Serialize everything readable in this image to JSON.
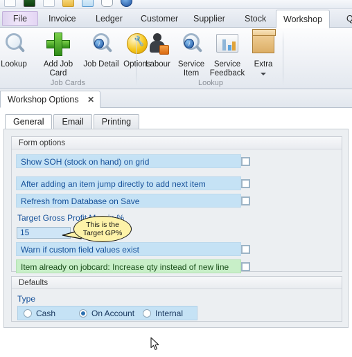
{
  "quick_access": {
    "icons": [
      "pencil-icon",
      "monitor-green-icon",
      "blank-page-icon",
      "folder-icon",
      "window-blue-icon",
      "comment-icon",
      "info-icon"
    ]
  },
  "ribbon": {
    "tabs": [
      {
        "label": "File",
        "active": false
      },
      {
        "label": "Invoice",
        "active": false
      },
      {
        "label": "Ledger",
        "active": false
      },
      {
        "label": "Customer",
        "active": false
      },
      {
        "label": "Supplier",
        "active": false
      },
      {
        "label": "Stock",
        "active": false
      },
      {
        "label": "Workshop",
        "active": true
      },
      {
        "label": "Qu",
        "active": false
      }
    ],
    "groups": [
      {
        "label": "Job Cards",
        "buttons": [
          {
            "label": "Lookup",
            "icon": "magnifier-icon"
          },
          {
            "label": "Add Job Card",
            "icon": "green-plus-icon"
          },
          {
            "label": "Job Detail",
            "icon": "magnifier-info-icon"
          },
          {
            "label": "Options",
            "icon": "yellow-wrench-icon"
          }
        ]
      },
      {
        "label": "Lookup",
        "buttons": [
          {
            "label": "Labour",
            "icon": "person-rss-icon"
          },
          {
            "label": "Service Item",
            "icon": "magnifier-info-icon"
          },
          {
            "label": "Service Feedback",
            "icon": "monitor-chart-icon"
          },
          {
            "label": "Extra",
            "icon": "box-icon",
            "has_dropdown": true
          }
        ]
      }
    ]
  },
  "document_tab": {
    "title": "Workshop Options",
    "close_label": "✕"
  },
  "inner_tabs": [
    {
      "label": "General",
      "selected": true
    },
    {
      "label": "Email",
      "selected": false
    },
    {
      "label": "Printing",
      "selected": false
    }
  ],
  "form": {
    "form_options": {
      "header": "Form options",
      "rows": [
        {
          "label": "Show SOH (stock on hand) on grid",
          "checked": false,
          "tone": "blue"
        },
        {
          "label": "After adding an item jump directly to add next item",
          "checked": false,
          "tone": "blue"
        },
        {
          "label": "Refresh from Database on Save",
          "checked": false,
          "tone": "blue"
        },
        {
          "label": "Warn if custom field values exist",
          "checked": false,
          "tone": "blue"
        },
        {
          "label": "Item already on jobcard: Increase qty instead of new line",
          "checked": false,
          "tone": "green"
        }
      ],
      "gp_label": "Target Gross Profit Margin %",
      "gp_value": "15"
    },
    "defaults": {
      "header": "Defaults",
      "type_label": "Type",
      "options": [
        {
          "label": "Cash",
          "selected": false
        },
        {
          "label": "On Account",
          "selected": true
        },
        {
          "label": "Internal",
          "selected": false
        }
      ]
    }
  },
  "callout": {
    "line1": "This is the",
    "line2": "Target GP%"
  },
  "colors": {
    "row_blue": "#c5e2f5",
    "row_green": "#c8efc8",
    "text_blue": "#16519a",
    "callout_fill": "#fdf2a8",
    "panel_bg": "#eceff2"
  }
}
